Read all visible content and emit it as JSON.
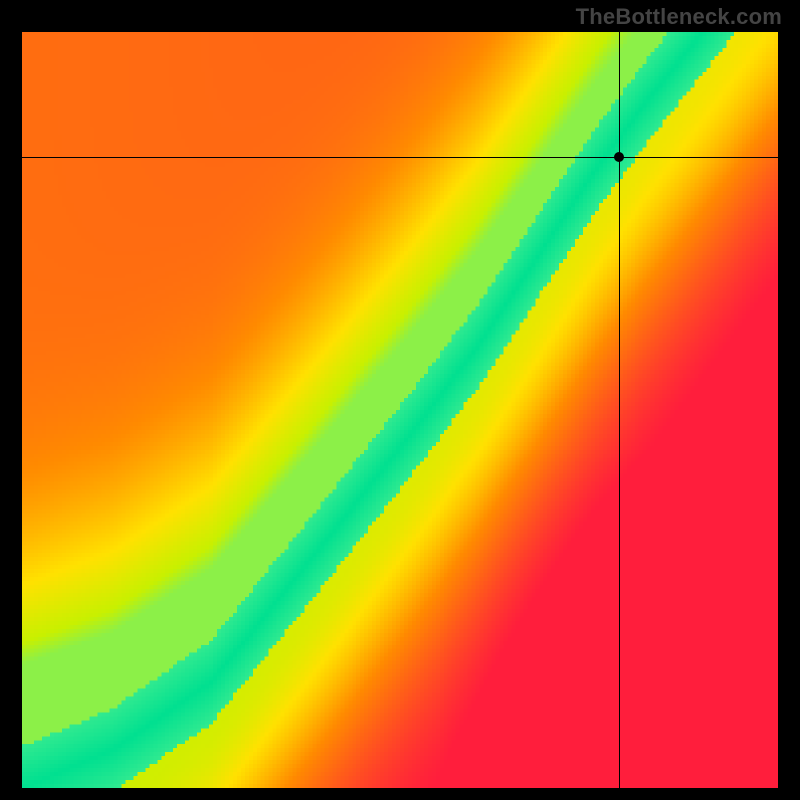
{
  "watermark": "TheBottleneck.com",
  "chart_data": {
    "type": "heatmap",
    "title": "",
    "xlabel": "",
    "ylabel": "",
    "xlim": [
      0,
      1
    ],
    "ylim": [
      0,
      1
    ],
    "crosshair": {
      "x": 0.79,
      "y": 0.835
    },
    "marker_point": {
      "x": 0.79,
      "y": 0.835
    },
    "colormap_stops": [
      {
        "value": 0.0,
        "color": "#ff1e3c"
      },
      {
        "value": 0.45,
        "color": "#ff8a00"
      },
      {
        "value": 0.7,
        "color": "#ffe100"
      },
      {
        "value": 0.85,
        "color": "#c8f000"
      },
      {
        "value": 0.95,
        "color": "#50f090"
      },
      {
        "value": 1.0,
        "color": "#00e090"
      }
    ],
    "ridge": {
      "description": "Center of high-value green band; y as a function of x (monotone curve with slight S-bend).",
      "control_points": [
        {
          "x": 0.0,
          "y": 0.0
        },
        {
          "x": 0.12,
          "y": 0.05
        },
        {
          "x": 0.25,
          "y": 0.14
        },
        {
          "x": 0.38,
          "y": 0.3
        },
        {
          "x": 0.5,
          "y": 0.45
        },
        {
          "x": 0.6,
          "y": 0.58
        },
        {
          "x": 0.68,
          "y": 0.7
        },
        {
          "x": 0.76,
          "y": 0.82
        },
        {
          "x": 0.82,
          "y": 0.9
        },
        {
          "x": 0.9,
          "y": 1.0
        }
      ],
      "band_halfwidth_y": 0.055
    },
    "background_gradient": {
      "description": "Value falls off with perpendicular distance from ridge; far lower-right is deep red, far upper-left moderately orange/yellow.",
      "falloff_scale": 0.28
    }
  }
}
